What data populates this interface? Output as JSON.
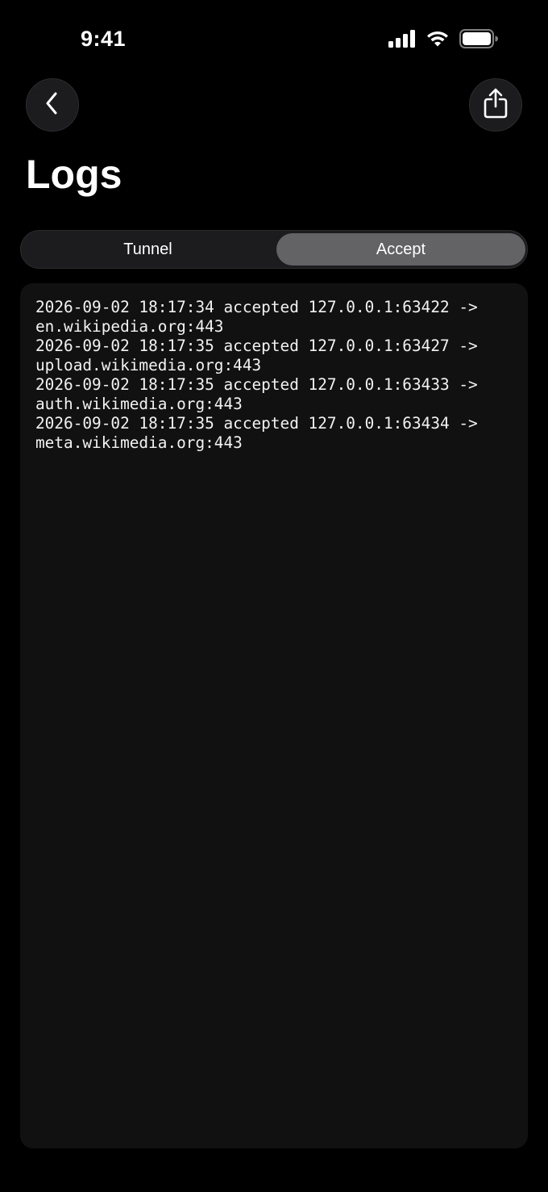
{
  "status_bar": {
    "time": "9:41",
    "icons": [
      "cellular-signal-icon",
      "wifi-icon",
      "battery-icon"
    ]
  },
  "nav": {
    "back_icon": "chevron-left-icon",
    "share_icon": "share-icon"
  },
  "page": {
    "title": "Logs"
  },
  "segments": {
    "items": [
      {
        "label": "Tunnel",
        "selected": false
      },
      {
        "label": "Accept",
        "selected": true
      }
    ]
  },
  "logs": {
    "lines": [
      "2026-09-02 18:17:34 accepted 127.0.0.1:63422 ->",
      "en.wikipedia.org:443",
      "2026-09-02 18:17:35 accepted 127.0.0.1:63427 ->",
      "upload.wikimedia.org:443",
      "2026-09-02 18:17:35 accepted 127.0.0.1:63433 ->",
      "auth.wikimedia.org:443",
      "2026-09-02 18:17:35 accepted 127.0.0.1:63434 ->",
      "meta.wikimedia.org:443"
    ]
  },
  "colors": {
    "background": "#000000",
    "surface": "#1c1c1e",
    "log_panel": "#111111",
    "segment_selected": "#636366",
    "text": "#ffffff"
  }
}
